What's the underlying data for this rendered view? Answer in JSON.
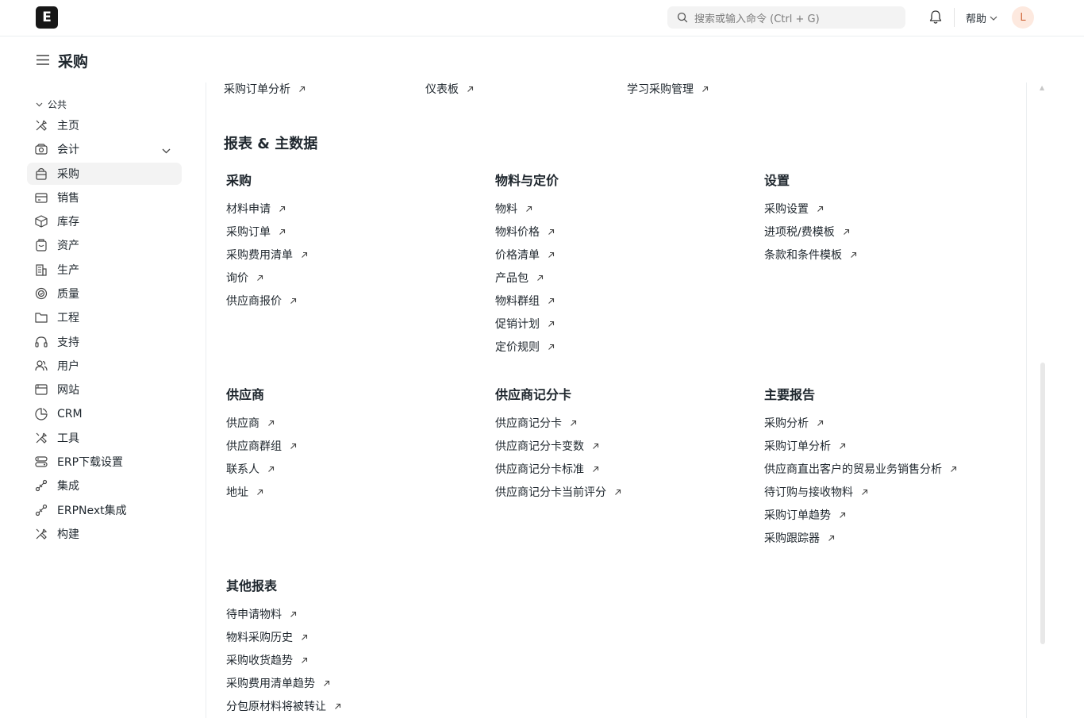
{
  "navbar": {
    "logo": "E",
    "search_placeholder": "搜索或输入命令 (Ctrl + G)",
    "help": "帮助",
    "avatar": "L"
  },
  "page": {
    "title": "采购"
  },
  "sidebar": {
    "group": "公共",
    "items": [
      {
        "label": "主页",
        "icon": "tools-icon"
      },
      {
        "label": "会计",
        "icon": "accounting-icon"
      },
      {
        "label": "采购",
        "icon": "buying-icon",
        "active": true
      },
      {
        "label": "销售",
        "icon": "sales-icon"
      },
      {
        "label": "库存",
        "icon": "stock-icon"
      },
      {
        "label": "资产",
        "icon": "assets-icon"
      },
      {
        "label": "生产",
        "icon": "manufacturing-icon"
      },
      {
        "label": "质量",
        "icon": "quality-icon"
      },
      {
        "label": "工程",
        "icon": "folder-icon"
      },
      {
        "label": "支持",
        "icon": "headset-icon"
      },
      {
        "label": "用户",
        "icon": "users-icon"
      },
      {
        "label": "网站",
        "icon": "website-icon"
      },
      {
        "label": "CRM",
        "icon": "crm-icon"
      },
      {
        "label": "工具",
        "icon": "tools-icon"
      },
      {
        "label": "ERP下载设置",
        "icon": "settings-icon"
      },
      {
        "label": "集成",
        "icon": "integration-icon"
      },
      {
        "label": "ERPNext集成",
        "icon": "integration-icon"
      },
      {
        "label": "构建",
        "icon": "build-icon"
      }
    ]
  },
  "shortcuts": [
    "采购订单分析",
    "仪表板",
    "学习采购管理"
  ],
  "reports_title": "报表 & 主数据",
  "cards": [
    {
      "title": "采购",
      "links": [
        "材料申请",
        "采购订单",
        "采购费用清单",
        "询价",
        "供应商报价"
      ]
    },
    {
      "title": "物料与定价",
      "links": [
        "物料",
        "物料价格",
        "价格清单",
        "产品包",
        "物料群组",
        "促销计划",
        "定价规则"
      ]
    },
    {
      "title": "设置",
      "links": [
        "采购设置",
        "进项税/费模板",
        "条款和条件模板"
      ]
    },
    {
      "title": "供应商",
      "links": [
        "供应商",
        "供应商群组",
        "联系人",
        "地址"
      ]
    },
    {
      "title": "供应商记分卡",
      "links": [
        "供应商记分卡",
        "供应商记分卡变数",
        "供应商记分卡标准",
        "供应商记分卡当前评分"
      ]
    },
    {
      "title": "主要报告",
      "links": [
        "采购分析",
        "采购订单分析",
        "供应商直出客户的贸易业务销售分析",
        "待订购与接收物料",
        "采购订单趋势",
        "采购跟踪器"
      ]
    },
    {
      "title": "其他报表",
      "links": [
        "待申请物料",
        "物料采购历史",
        "采购收货趋势",
        "采购费用清单趋势",
        "分包原材料将被转让"
      ]
    }
  ]
}
